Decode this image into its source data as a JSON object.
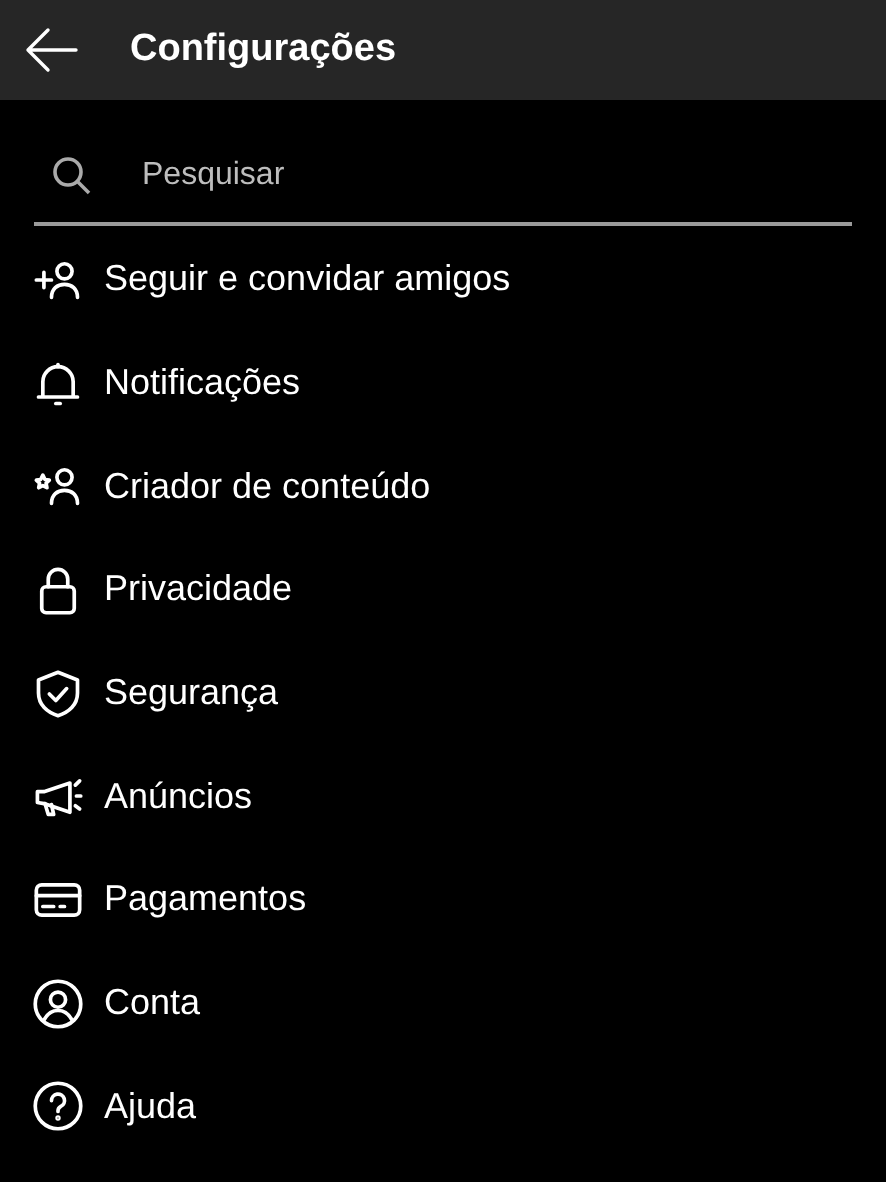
{
  "header": {
    "title": "Configurações"
  },
  "search": {
    "placeholder": "Pesquisar"
  },
  "items": [
    {
      "kind": "add-person",
      "label": "Seguir e convidar amigos"
    },
    {
      "kind": "bell",
      "label": "Notificações"
    },
    {
      "kind": "star-person",
      "label": "Criador de conteúdo"
    },
    {
      "kind": "lock",
      "label": "Privacidade"
    },
    {
      "kind": "shield",
      "label": "Segurança"
    },
    {
      "kind": "megaphone",
      "label": "Anúncios"
    },
    {
      "kind": "card",
      "label": "Pagamentos"
    },
    {
      "kind": "account",
      "label": "Conta"
    },
    {
      "kind": "help",
      "label": "Ajuda"
    }
  ]
}
